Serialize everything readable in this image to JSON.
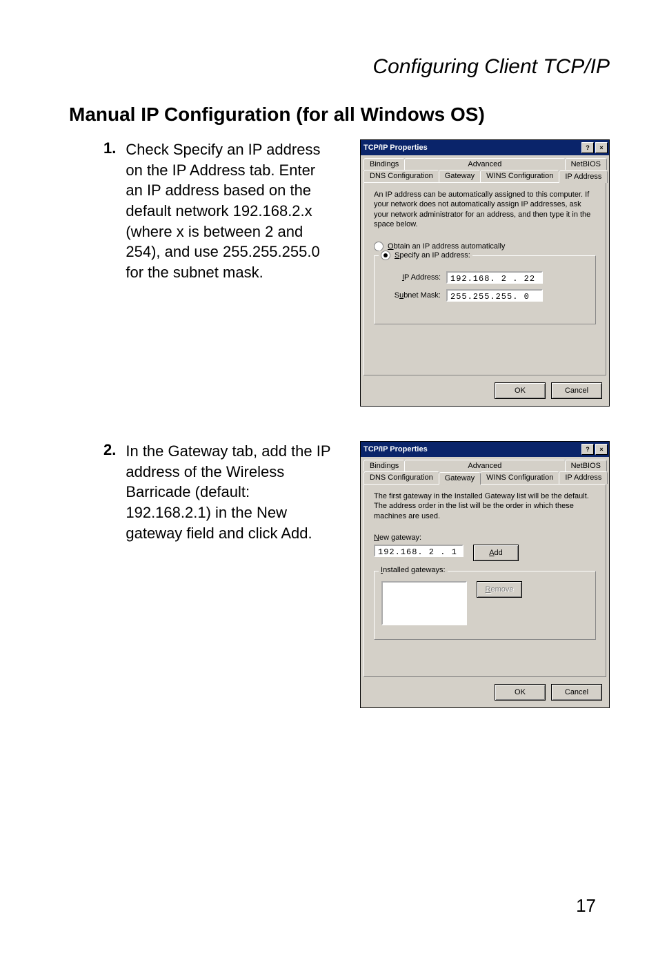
{
  "header": {
    "title": "Configuring Client TCP/IP"
  },
  "section": {
    "title": "Manual IP Configuration (for all Windows OS)"
  },
  "steps": [
    {
      "num": "1.",
      "text": "Check Specify an IP address on the IP Address tab. Enter an IP address based on the default network 192.168.2.x (where x is between 2 and 254), and use 255.255.255.0 for the subnet mask."
    },
    {
      "num": "2.",
      "text": "In the Gateway tab, add the IP address of the Wireless Barricade (default: 192.168.2.1) in the New gateway field and click Add."
    }
  ],
  "dialog1": {
    "title": "TCP/IP Properties",
    "helpIcon": "?",
    "closeIcon": "×",
    "tabsRow1": [
      "Bindings",
      "Advanced",
      "NetBIOS"
    ],
    "tabsRow2": [
      "DNS Configuration",
      "Gateway",
      "WINS Configuration",
      "IP Address"
    ],
    "activeTab": "IP Address",
    "panelText": "An IP address can be automatically assigned to this computer. If your network does not automatically assign IP addresses, ask your network administrator for an address, and then type it in the space below.",
    "radioAuto": "Obtain an IP address automatically",
    "radioSpecify": "Specify an IP address:",
    "ipLabel": "IP Address:",
    "ipValue": "192.168. 2 . 22",
    "maskLabel": "Subnet Mask:",
    "maskValue": "255.255.255. 0",
    "ok": "OK",
    "cancel": "Cancel"
  },
  "dialog2": {
    "title": "TCP/IP Properties",
    "helpIcon": "?",
    "closeIcon": "×",
    "tabsRow1": [
      "Bindings",
      "Advanced",
      "NetBIOS"
    ],
    "tabsRow2": [
      "DNS Configuration",
      "Gateway",
      "WINS Configuration",
      "IP Address"
    ],
    "activeTab": "Gateway",
    "panelText": "The first gateway in the Installed Gateway list will be the default. The address order in the list will be the order in which these machines are used.",
    "newGwLabel": "New gateway:",
    "newGwValue": "192.168. 2 . 1",
    "addBtn": "Add",
    "instGwLabel": "Installed gateways:",
    "removeBtn": "Remove",
    "ok": "OK",
    "cancel": "Cancel"
  },
  "pageNumber": "17"
}
